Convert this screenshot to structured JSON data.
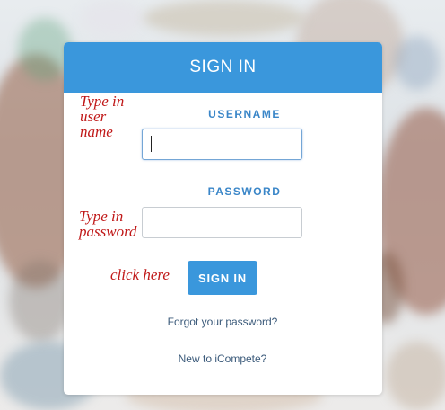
{
  "header": {
    "title": "SIGN IN"
  },
  "form": {
    "username_label": "USERNAME",
    "username_value": "",
    "password_label": "PASSWORD",
    "password_value": "",
    "submit_label": "SIGN IN"
  },
  "links": {
    "forgot": "Forgot your password?",
    "register": "New to iCompete?"
  },
  "annotations": {
    "username_hint": "Type in user name",
    "password_hint": "Type in password",
    "click_hint": "click here"
  },
  "colors": {
    "accent": "#3a97dc",
    "annotation": "#c01818",
    "label": "#3a86c8"
  }
}
